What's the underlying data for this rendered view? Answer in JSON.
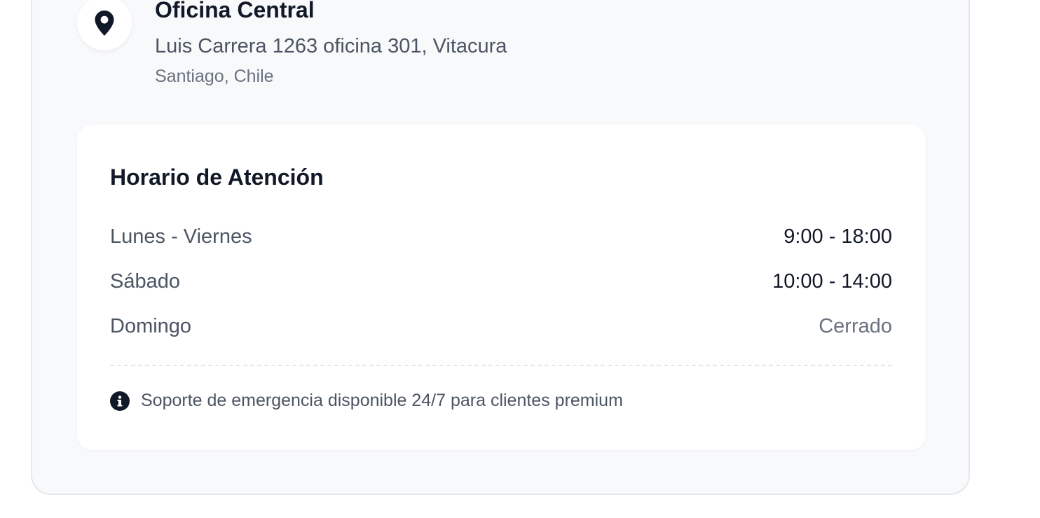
{
  "office": {
    "icon": "map-pin-icon",
    "title": "Oficina Central",
    "address": "Luis Carrera 1263 oficina 301, Vitacura",
    "city": "Santiago, Chile"
  },
  "hours": {
    "title": "Horario de Atención",
    "rows": [
      {
        "day": "Lunes - Viernes",
        "time": "9:00 - 18:00"
      },
      {
        "day": "Sábado",
        "time": "10:00 - 14:00"
      },
      {
        "day": "Domingo",
        "time": "Cerrado"
      }
    ],
    "note_icon": "info-icon",
    "note": "Soporte de emergencia disponible 24/7 para clientes premium"
  },
  "colors": {
    "card_background": "#f8f9fb",
    "heading": "#111827",
    "body_text": "#4b5563",
    "muted_text": "#6b7280"
  }
}
